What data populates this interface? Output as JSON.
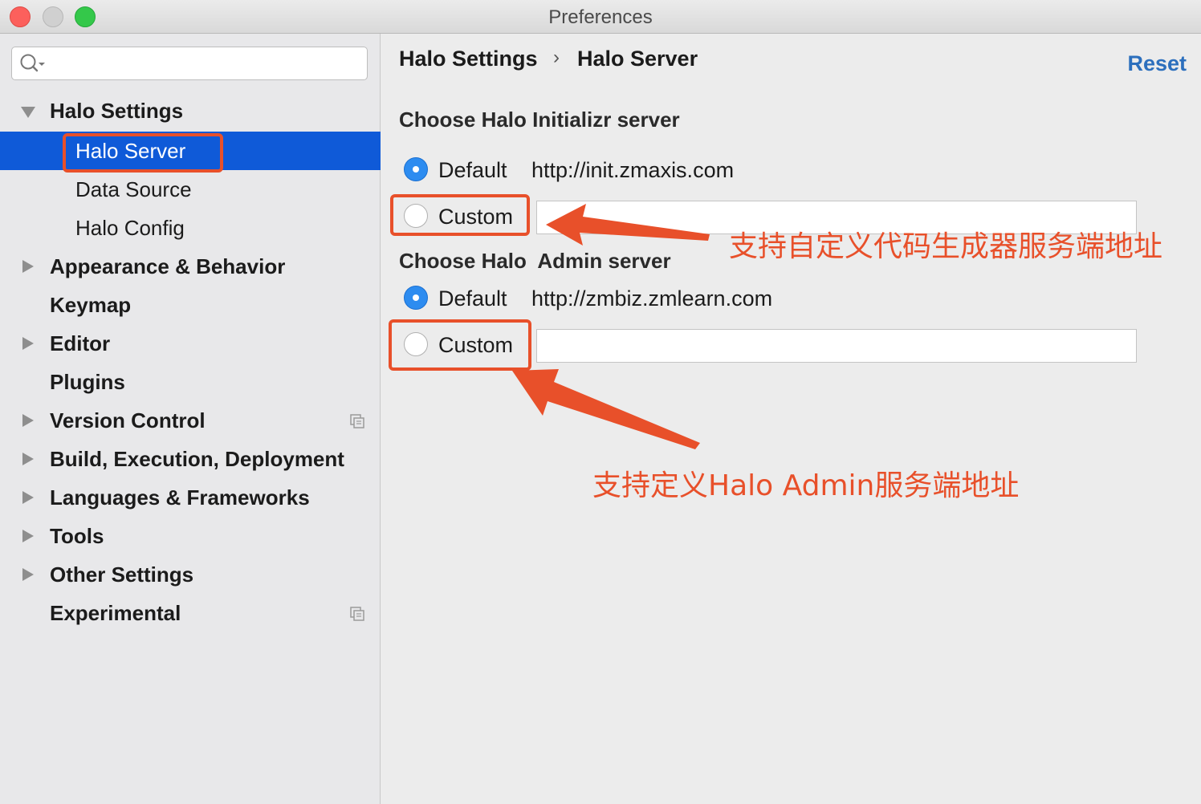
{
  "window": {
    "title": "Preferences"
  },
  "search": {
    "placeholder": "",
    "value": ""
  },
  "sidebar": {
    "items": [
      {
        "label": "Halo Settings"
      },
      {
        "label": "Halo Server"
      },
      {
        "label": "Data Source"
      },
      {
        "label": "Halo Config"
      },
      {
        "label": "Appearance & Behavior"
      },
      {
        "label": "Keymap"
      },
      {
        "label": "Editor"
      },
      {
        "label": "Plugins"
      },
      {
        "label": "Version Control"
      },
      {
        "label": "Build, Execution, Deployment"
      },
      {
        "label": "Languages & Frameworks"
      },
      {
        "label": "Tools"
      },
      {
        "label": "Other Settings"
      },
      {
        "label": "Experimental"
      }
    ]
  },
  "header": {
    "breadcrumb_parent": "Halo Settings",
    "separator": "›",
    "breadcrumb_current": "Halo Server",
    "reset_label": "Reset"
  },
  "initializr": {
    "title": "Choose Halo Initializr server",
    "default_label": "Default",
    "default_url": "http://init.zmaxis.com",
    "custom_label": "Custom",
    "custom_value": "",
    "selected": "Default"
  },
  "admin": {
    "title": "Choose Halo  Admin server",
    "default_label": "Default",
    "default_url": "http://zmbiz.zmlearn.com",
    "custom_label": "Custom",
    "custom_value": "",
    "selected": "Default"
  },
  "annotations": {
    "initializr_note": "支持自定义代码生成器服务端地址",
    "admin_note": "支持定义Halo Admin服务端地址"
  },
  "colors": {
    "selection": "#0f5ad8",
    "accent_link": "#2c6fbd",
    "annotation": "#e8502a",
    "radio_checked": "#2d8cf0"
  }
}
